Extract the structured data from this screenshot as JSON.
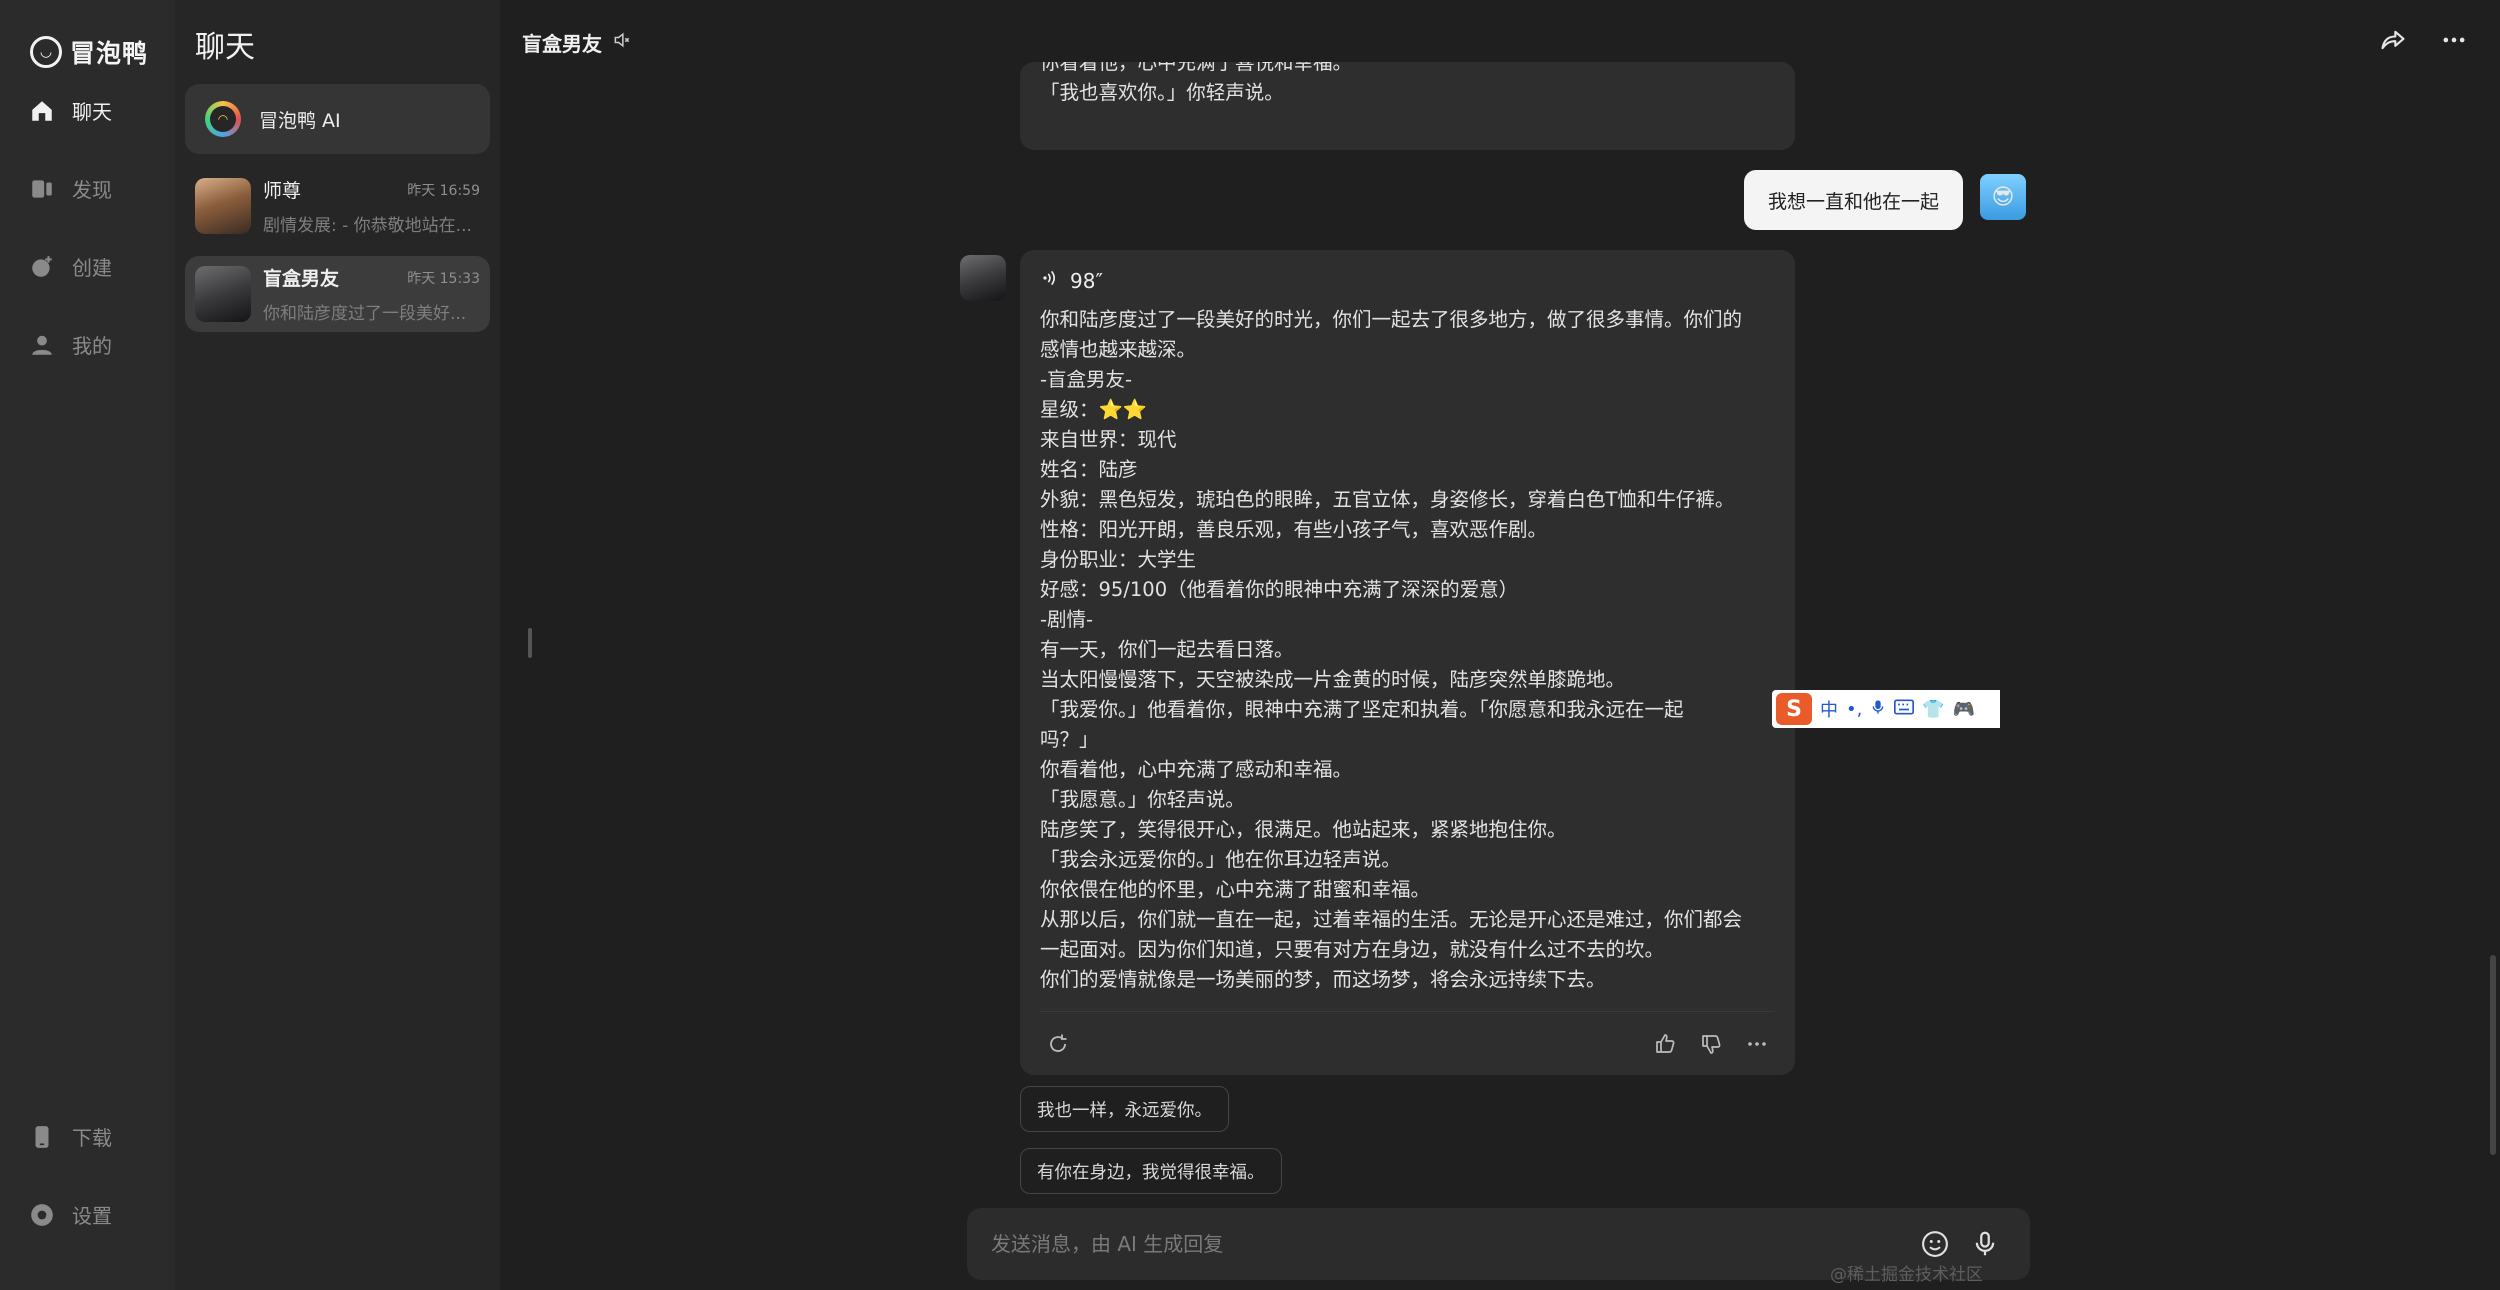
{
  "app": {
    "logo_text": "冒泡鸭"
  },
  "nav": {
    "items": [
      {
        "label": "聊天",
        "icon": "home-icon"
      },
      {
        "label": "发现",
        "icon": "discover-icon"
      },
      {
        "label": "创建",
        "icon": "create-icon"
      },
      {
        "label": "我的",
        "icon": "user-icon"
      }
    ],
    "bottom": [
      {
        "label": "下载",
        "icon": "phone-icon"
      },
      {
        "label": "设置",
        "icon": "settings-icon"
      }
    ]
  },
  "conversations": {
    "title": "聊天",
    "ai": {
      "name": "冒泡鸭 AI"
    },
    "items": [
      {
        "name": "师尊",
        "time": "昨天 16:59",
        "preview": "剧情发展: - 你恭敬地站在..."
      },
      {
        "name": "盲盒男友",
        "time": "昨天 15:33",
        "preview": "你和陆彦度过了一段美好..."
      }
    ]
  },
  "header": {
    "title": "盲盒男友"
  },
  "messages": {
    "prev_fragment": "你看着他，心中充满了喜悦和幸福。\n「我也喜欢你。」你轻声说。",
    "user_message": "我想一直和他在一起",
    "voice_duration": "98″",
    "bot_reply": "你和陆彦度过了一段美好的时光，你们一起去了很多地方，做了很多事情。你们的\n感情也越来越深。\n-盲盒男友-\n星级：⭐⭐\n来自世界：现代\n姓名：陆彦\n外貌：黑色短发，琥珀色的眼眸，五官立体，身姿修长，穿着白色T恤和牛仔裤。\n性格：阳光开朗，善良乐观，有些小孩子气，喜欢恶作剧。\n身份职业：大学生\n好感：95/100（他看着你的眼神中充满了深深的爱意）\n-剧情-\n有一天，你们一起去看日落。\n当太阳慢慢落下，天空被染成一片金黄的时候，陆彦突然单膝跪地。\n「我爱你。」他看着你，眼神中充满了坚定和执着。「你愿意和我永远在一起\n吗？」\n你看着他，心中充满了感动和幸福。\n「我愿意。」你轻声说。\n陆彦笑了，笑得很开心，很满足。他站起来，紧紧地抱住你。\n「我会永远爱你的。」他在你耳边轻声说。\n你依偎在他的怀里，心中充满了甜蜜和幸福。\n从那以后，你们就一直在一起，过着幸福的生活。无论是开心还是难过，你们都会\n一起面对。因为你们知道，只要有对方在身边，就没有什么过不去的坎。\n你们的爱情就像是一场美丽的梦，而这场梦，将会永远持续下去。"
  },
  "suggestions": [
    "我也一样，永远爱你。",
    "有你在身边，我觉得很幸福。"
  ],
  "input": {
    "placeholder": "发送消息，由 AI 生成回复"
  },
  "ime": {
    "label": "中"
  },
  "watermark": "@稀土掘金技术社区",
  "colors": {
    "background": "#1f1f1f",
    "sidebar": "#2b2b2b",
    "bubble": "#2e2e2e",
    "user_bubble": "#f4f4f4"
  }
}
